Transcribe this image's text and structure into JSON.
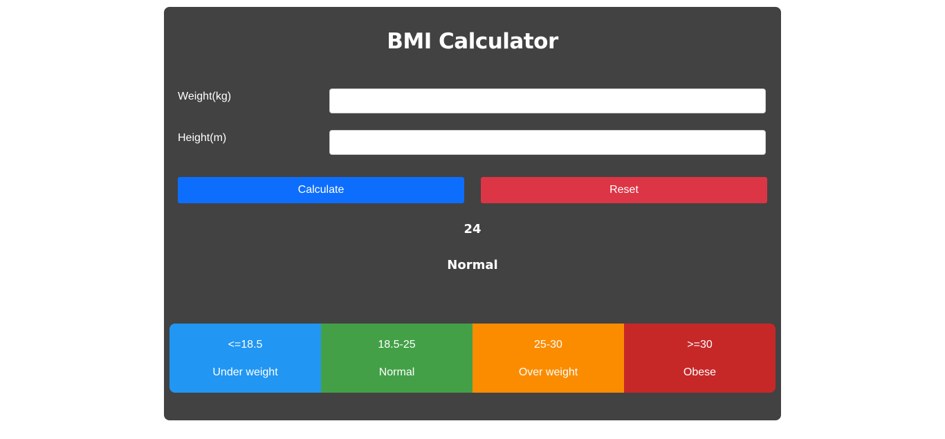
{
  "app": {
    "title": "BMI Calculator"
  },
  "form": {
    "weight_label": "Weight(kg)",
    "weight_value": "",
    "height_label": "Height(m)",
    "height_value": ""
  },
  "actions": {
    "calculate_label": "Calculate",
    "reset_label": "Reset"
  },
  "result": {
    "bmi": "24",
    "category": "Normal"
  },
  "scale": [
    {
      "range": "<=18.5",
      "name": "Under weight",
      "color": "#2196f3"
    },
    {
      "range": "18.5-25",
      "name": "Normal",
      "color": "#43a047"
    },
    {
      "range": "25-30",
      "name": "Over weight",
      "color": "#fb8c00"
    },
    {
      "range": ">=30",
      "name": "Obese",
      "color": "#c62828"
    }
  ],
  "colors": {
    "card_background": "#424242",
    "calculate_button": "#0d6efd",
    "reset_button": "#dc3545"
  }
}
